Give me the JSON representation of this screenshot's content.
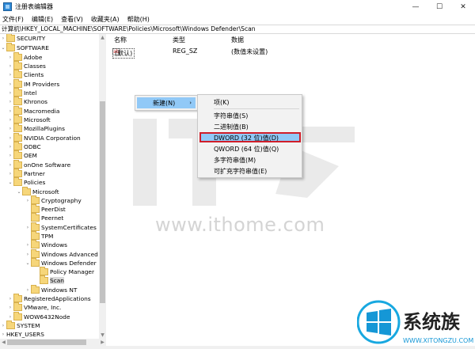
{
  "window": {
    "title": "注册表编辑器"
  },
  "window_buttons": {
    "minimize": "—",
    "maximize": "☐",
    "close": "✕"
  },
  "menubar": [
    "文件(F)",
    "编辑(E)",
    "查看(V)",
    "收藏夹(A)",
    "帮助(H)"
  ],
  "address": "计算机\\HKEY_LOCAL_MACHINE\\SOFTWARE\\Policies\\Microsoft\\Windows Defender\\Scan",
  "tree": {
    "items": [
      {
        "label": "SECURITY"
      },
      {
        "label": "SOFTWARE"
      },
      {
        "label": "Adobe"
      },
      {
        "label": "Classes"
      },
      {
        "label": "Clients"
      },
      {
        "label": "IM Providers"
      },
      {
        "label": "Intel"
      },
      {
        "label": "Khronos"
      },
      {
        "label": "Macromedia"
      },
      {
        "label": "Microsoft"
      },
      {
        "label": "MozillaPlugins"
      },
      {
        "label": "NVIDIA Corporation"
      },
      {
        "label": "ODBC"
      },
      {
        "label": "OEM"
      },
      {
        "label": "onOne Software"
      },
      {
        "label": "Partner"
      },
      {
        "label": "Policies"
      },
      {
        "label": "Microsoft"
      },
      {
        "label": "Cryptography"
      },
      {
        "label": "PeerDist"
      },
      {
        "label": "Peernet"
      },
      {
        "label": "SystemCertificates"
      },
      {
        "label": "TPM"
      },
      {
        "label": "Windows"
      },
      {
        "label": "Windows Advanced T"
      },
      {
        "label": "Windows Defender"
      },
      {
        "label": "Policy Manager"
      },
      {
        "label": "Scan"
      },
      {
        "label": "Windows NT"
      },
      {
        "label": "RegisteredApplications"
      },
      {
        "label": "VMware, Inc."
      },
      {
        "label": "WOW6432Node"
      },
      {
        "label": "SYSTEM"
      },
      {
        "label": "HKEY_USERS"
      }
    ]
  },
  "list": {
    "headers": [
      "名称",
      "类型",
      "数据"
    ],
    "rows": [
      {
        "icon": "ab",
        "name": "(默认)",
        "type": "REG_SZ",
        "data": "(数值未设置)"
      }
    ]
  },
  "context_menu": {
    "new_label": "新建(N)",
    "submenu": [
      "项(K)",
      "字符串值(S)",
      "二进制值(B)",
      "DWORD (32 位)值(D)",
      "QWORD (64 位)值(Q)",
      "多字符串值(M)",
      "可扩充字符串值(E)"
    ]
  },
  "watermark": {
    "url": "www.ithome.com",
    "logo_text": "IT之家"
  },
  "corner_logo": {
    "name": "系统族",
    "url": "WWW.XITONGZU.COM"
  },
  "colors": {
    "highlight": "#91c9f7",
    "outline": "#d01e2a"
  }
}
